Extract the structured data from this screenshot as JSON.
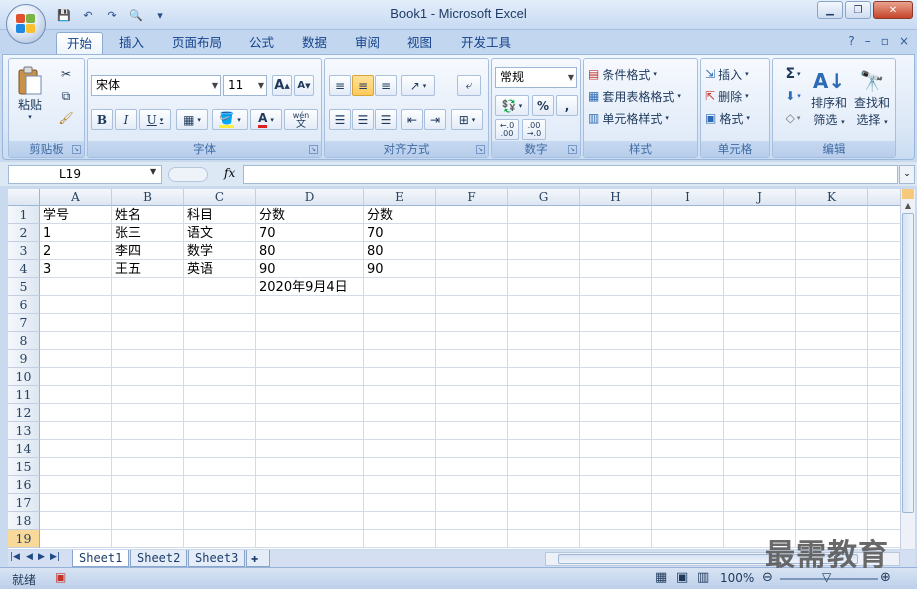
{
  "window": {
    "title": "Book1 - Microsoft Excel",
    "minimize": "▁",
    "restore": "❐",
    "close": "✕"
  },
  "qat": {
    "save": "💾",
    "undo": "↶",
    "redo": "↷",
    "print_preview": "🔍",
    "customize": "▾"
  },
  "tabs": [
    {
      "label": "开始"
    },
    {
      "label": "插入"
    },
    {
      "label": "页面布局"
    },
    {
      "label": "公式"
    },
    {
      "label": "数据"
    },
    {
      "label": "审阅"
    },
    {
      "label": "视图"
    },
    {
      "label": "开发工具"
    }
  ],
  "help": {
    "help": "?",
    "min": "–",
    "restore": "▫",
    "close": "×"
  },
  "ribbon": {
    "clipboard": {
      "label": "剪贴板",
      "paste": "粘贴"
    },
    "font": {
      "label": "字体",
      "name": "宋体",
      "size": "11",
      "grow": "A",
      "shrink": "A",
      "bold": "B",
      "italic": "I",
      "underline": "U",
      "wen": "wén",
      "wen2": "文"
    },
    "alignment": {
      "label": "对齐方式"
    },
    "number": {
      "label": "数字",
      "format": "常规",
      "percent": "%",
      "comma": ",",
      "inc_decimal": "←.0 .00",
      "dec_decimal": ".00 →.0"
    },
    "styles": {
      "label": "样式",
      "conditional": "条件格式",
      "table": "套用表格格式",
      "cell_styles": "单元格样式"
    },
    "cells": {
      "label": "单元格",
      "insert": "插入",
      "delete": "删除",
      "format": "格式"
    },
    "editing": {
      "label": "编辑",
      "sum": "Σ",
      "sort_filter_1": "排序和",
      "sort_filter_2": "筛选",
      "find_select_1": "查找和",
      "find_select_2": "选择"
    }
  },
  "formula_bar": {
    "name_box": "L19",
    "fx": "fx"
  },
  "columns": [
    "A",
    "B",
    "C",
    "D",
    "E",
    "F",
    "G",
    "H",
    "I",
    "J",
    "K"
  ],
  "rows": [
    "1",
    "2",
    "3",
    "4",
    "5",
    "6",
    "7",
    "8",
    "9",
    "10",
    "11",
    "12",
    "13",
    "14",
    "15",
    "16",
    "17",
    "18",
    "19"
  ],
  "cells": {
    "A1": "学号",
    "B1": "姓名",
    "C1": "科目",
    "D1": "分数",
    "E1": "分数",
    "A2": "1",
    "B2": "张三",
    "C2": "语文",
    "D2": "70",
    "E2": "70",
    "A3": "2",
    "B3": "李四",
    "C3": "数学",
    "D3": "80",
    "E3": "80",
    "A4": "3",
    "B4": "王五",
    "C4": "英语",
    "D4": "90",
    "E4": "90",
    "D5": "2020年9月4日"
  },
  "sheets": [
    {
      "label": "Sheet1"
    },
    {
      "label": "Sheet2"
    },
    {
      "label": "Sheet3"
    }
  ],
  "status": {
    "ready": "就绪",
    "zoom": "100%"
  },
  "watermark": "最需教育",
  "colors": {
    "accent": "#15428b",
    "selected_row": "#f9d99a",
    "gridline": "#d4dbe6"
  }
}
